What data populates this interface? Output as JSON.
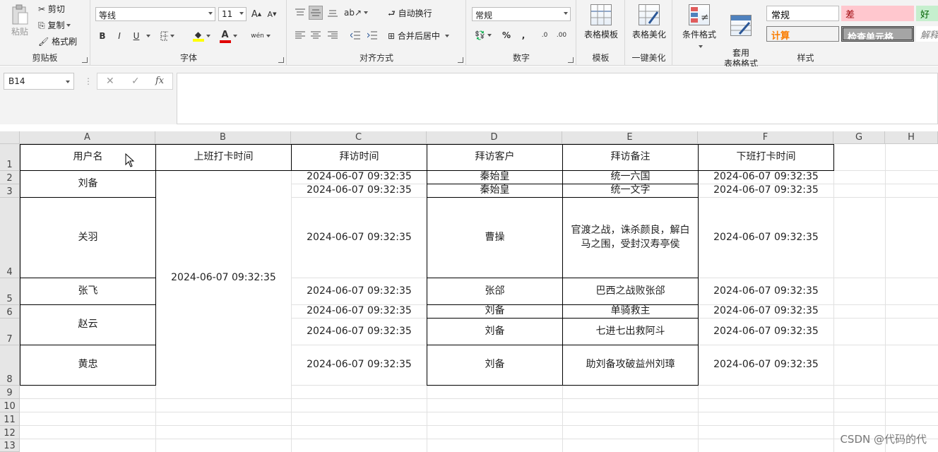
{
  "ribbon": {
    "clipboard": {
      "label": "剪贴板",
      "paste": "粘贴",
      "cut": "剪切",
      "copy": "复制",
      "format_painter": "格式刷"
    },
    "font": {
      "label": "字体",
      "name": "等线",
      "size": "11",
      "bold": "B",
      "italic": "I",
      "underline": "U",
      "grow": "A",
      "shrink": "A",
      "font_color_glyph": "A",
      "phonetic": "wén"
    },
    "alignment": {
      "label": "对齐方式",
      "wrap_text": "自动换行",
      "merge_center": "合并后居中"
    },
    "number": {
      "label": "数字",
      "format": "常规",
      "percent": "%",
      "comma": ",",
      "inc_decimal": ".0",
      "dec_decimal": ".00"
    },
    "templates": {
      "label": "模板",
      "table_template": "表格模板"
    },
    "beautify": {
      "label": "一键美化",
      "table_beautify": "表格美化"
    },
    "styles": {
      "label": "样式",
      "conditional": "条件格式",
      "format_table": "套用\n表格格式",
      "cells": [
        {
          "text": "常规",
          "bg": "#ffffff",
          "color": "#000000"
        },
        {
          "text": "差",
          "bg": "#ffc7ce",
          "color": "#9c0006"
        },
        {
          "text": "好",
          "bg": "#c6efce",
          "color": "#006100"
        },
        {
          "text": "计算",
          "bg": "#f2f2f2",
          "color": "#fa7d00"
        },
        {
          "text": "检查单元格",
          "bg": "#a5a5a5",
          "color": "#ffffff"
        },
        {
          "text": "解释",
          "bg": "#ffffff",
          "color": "#7f7f7f"
        }
      ]
    }
  },
  "formula_bar": {
    "name_box": "B14",
    "cancel": "✕",
    "enter": "✓",
    "fx": "fx",
    "value": ""
  },
  "columns": [
    "A",
    "B",
    "C",
    "D",
    "E",
    "F",
    "G",
    "H"
  ],
  "rows": [
    "1",
    "2",
    "3",
    "4",
    "5",
    "6",
    "7",
    "8",
    "9",
    "10",
    "11",
    "12",
    "13"
  ],
  "cells": {
    "A1": "用户名",
    "B1": "上班打卡时间",
    "C1": "拜访时间",
    "D1": "拜访客户",
    "E1": "拜访备注",
    "F1": "下班打卡时间",
    "A2": "刘备",
    "A4": "关羽",
    "A5": "张飞",
    "A6": "赵云",
    "A8": "黄忠",
    "B2": "2024-06-07 09:32:35",
    "C2": "2024-06-07 09:32:35",
    "C3": "2024-06-07 09:32:35",
    "C4": "2024-06-07 09:32:35",
    "C5": "2024-06-07 09:32:35",
    "C6": "2024-06-07 09:32:35",
    "C7": "2024-06-07 09:32:35",
    "C8": "2024-06-07 09:32:35",
    "D2": "秦始皇",
    "D3": "秦始皇",
    "D4": "曹操",
    "D5": "张郃",
    "D6": "刘备",
    "D7": "刘备",
    "D8": "刘备",
    "E2": "统一六国",
    "E3": "统一文字",
    "E4": "官渡之战，诛杀颜良，解白马之围，受封汉寿亭侯",
    "E5": "巴西之战败张郃",
    "E6": "单骑救主",
    "E7": "七进七出救阿斗",
    "E8": "助刘备攻破益州刘璋",
    "F2": "2024-06-07 09:32:35",
    "F3": "2024-06-07 09:32:35",
    "F4": "2024-06-07 09:32:35",
    "F5": "2024-06-07 09:32:35",
    "F6": "2024-06-07 09:32:35",
    "F7": "2024-06-07 09:32:35",
    "F8": "2024-06-07 09:32:35"
  },
  "watermark": "CSDN @代码的代"
}
